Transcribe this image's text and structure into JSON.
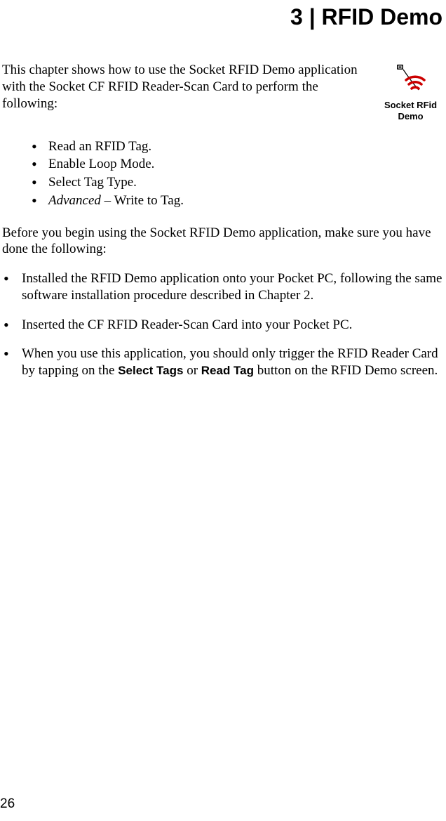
{
  "chapter": {
    "title": "3 | RFID Demo"
  },
  "logo": {
    "caption_line1": "Socket RFid",
    "caption_line2": "Demo"
  },
  "intro": "This chapter shows how to use the Socket RFID Demo application with the Socket CF RFID Reader-Scan Card to perform the following:",
  "features": [
    {
      "text": "Read an RFID Tag."
    },
    {
      "text": "Enable Loop Mode."
    },
    {
      "text": "Select Tag Type."
    },
    {
      "prefix_italic": "Advanced",
      "suffix": " – Write to Tag."
    }
  ],
  "before_para": "Before you begin using the Socket RFID Demo application, make sure you have done the following:",
  "prereqs": [
    {
      "plain": "Installed the RFID Demo application onto your Pocket PC, following the same software installation procedure described in Chapter 2."
    },
    {
      "plain": "Inserted the CF RFID Reader-Scan Card into your Pocket PC."
    }
  ],
  "prereq3": {
    "seg1": "When you use this application, you should only trigger the RFID Reader Card by tapping on the ",
    "strong1": "Select Tags",
    "seg2": " or ",
    "strong2": "Read Tag",
    "seg3": " button on the RFID Demo screen."
  },
  "page_number": "26"
}
